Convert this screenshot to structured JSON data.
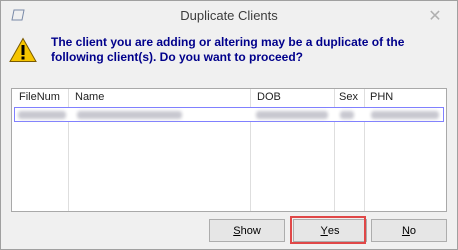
{
  "window": {
    "title": "Duplicate Clients",
    "close_glyph": "✕"
  },
  "message": {
    "line1": "The client you are adding or altering may be a duplicate of the",
    "line2": "following client(s). Do you want to proceed?"
  },
  "grid": {
    "columns": [
      "FileNum",
      "Name",
      "DOB",
      "Sex",
      "PHN"
    ],
    "rows": [
      {
        "filenum": "",
        "name": "",
        "dob": "",
        "sex": "",
        "phn": "",
        "redacted": true
      }
    ]
  },
  "buttons": {
    "show": {
      "mnemonic": "S",
      "rest": "how"
    },
    "yes": {
      "mnemonic": "Y",
      "rest": "es"
    },
    "no": {
      "mnemonic": "N",
      "rest": "o"
    }
  },
  "icons": {
    "app": "window-icon",
    "warning": "warning-triangle-icon",
    "close": "close-icon"
  },
  "colors": {
    "message_text": "#00008b",
    "highlight": "#e04848",
    "row_border": "#8080ff"
  }
}
